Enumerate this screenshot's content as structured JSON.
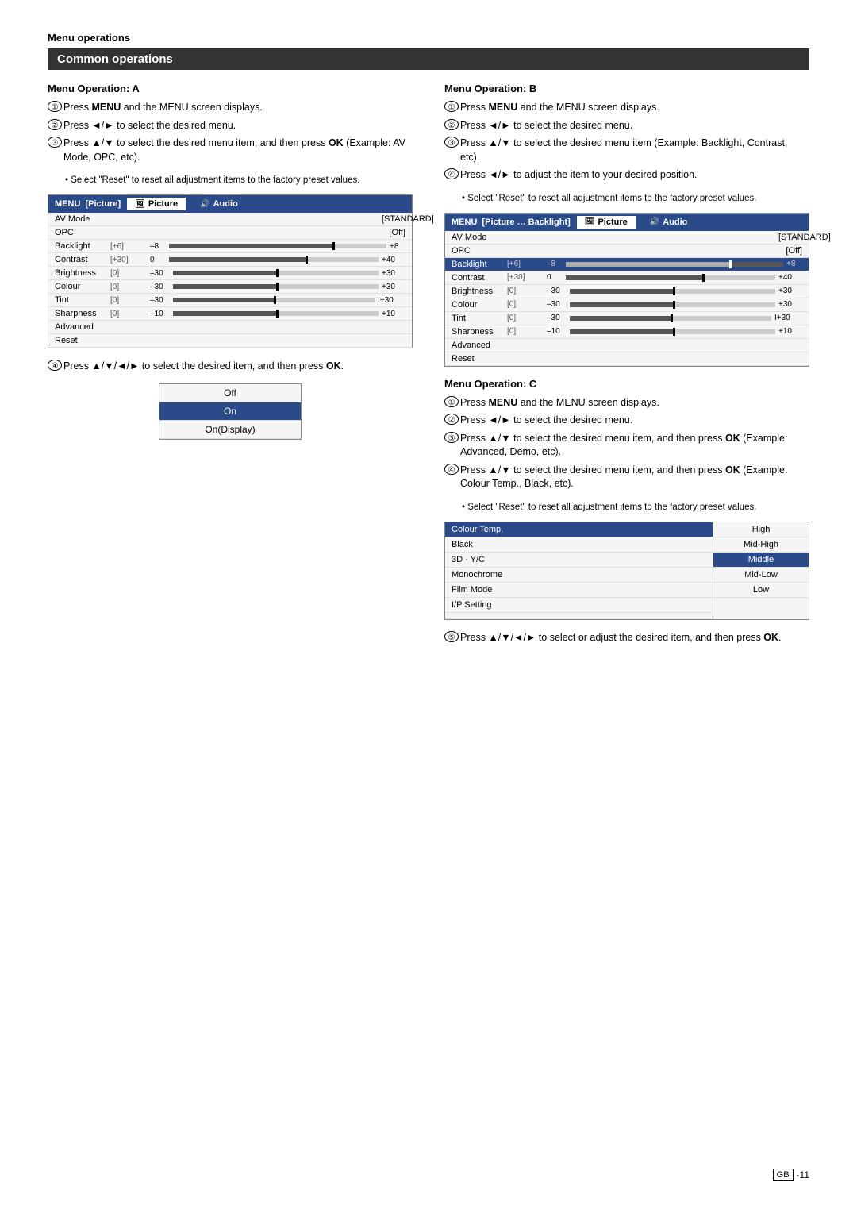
{
  "page": {
    "section_label": "Menu operations",
    "main_title": "Common operations",
    "col_left": {
      "section_title": "Menu Operation: A",
      "steps": [
        {
          "num": "①",
          "text": "Press <b>MENU</b> and the MENU screen displays."
        },
        {
          "num": "②",
          "text": "Press ◄/► to select the desired menu."
        },
        {
          "num": "③",
          "text": "Press ▲/▼ to select the desired menu item, and then press <b>OK</b> (Example: AV Mode, OPC, etc).",
          "bullet": "• Select \"Reset\" to reset all adjustment items to the factory preset values."
        },
        {
          "num": "④",
          "text": "Press ▲/▼/◄/► to select the desired item, and then press <b>OK</b>."
        }
      ],
      "menu_a": {
        "header_label": "MENU",
        "header_tab": "[Picture]",
        "tab1": "Picture",
        "tab2": "Audio",
        "rows": [
          {
            "label": "AV Mode",
            "range": "",
            "value": "[STANDARD]",
            "type": "text"
          },
          {
            "label": "OPC",
            "range": "",
            "value": "[Off]",
            "type": "text"
          },
          {
            "label": "Backlight",
            "range": "[+6]",
            "min": "–8",
            "max": "+8",
            "pos": 75,
            "type": "slider"
          },
          {
            "label": "Contrast",
            "range": "[+30]",
            "min": "0",
            "max": "+40",
            "pos": 65,
            "type": "slider"
          },
          {
            "label": "Brightness",
            "range": "[0]",
            "min": "–30",
            "max": "+30",
            "pos": 50,
            "type": "slider"
          },
          {
            "label": "Colour",
            "range": "[0]",
            "min": "–30",
            "max": "+30",
            "pos": 50,
            "type": "slider"
          },
          {
            "label": "Tint",
            "range": "[0]",
            "min": "–30",
            "max": "I+30",
            "pos": 50,
            "type": "slider"
          },
          {
            "label": "Sharpness",
            "range": "[0]",
            "min": "–10",
            "max": "+10",
            "pos": 50,
            "type": "slider"
          },
          {
            "label": "Advanced",
            "range": "",
            "value": "",
            "type": "link"
          },
          {
            "label": "Reset",
            "range": "",
            "value": "",
            "type": "link"
          }
        ]
      },
      "submenu": {
        "items": [
          "Off",
          "On",
          "On(Display)"
        ],
        "selected": 1
      }
    },
    "col_right": {
      "section_b_title": "Menu Operation: B",
      "steps_b": [
        {
          "num": "①",
          "text": "Press <b>MENU</b> and the MENU screen displays."
        },
        {
          "num": "②",
          "text": "Press ◄/► to select the desired menu."
        },
        {
          "num": "③",
          "text": "Press ▲/▼ to select the desired menu item (Example: Backlight, Contrast, etc)."
        },
        {
          "num": "④",
          "text": "Press ◄/► to adjust the item to your desired position.",
          "bullet": "• Select \"Reset\" to reset all adjustment items to the factory preset values."
        }
      ],
      "menu_b": {
        "header_label": "MENU",
        "header_tab": "[Picture … Backlight]",
        "tab1": "Picture",
        "tab2": "Audio",
        "rows": [
          {
            "label": "AV Mode",
            "range": "",
            "value": "[STANDARD]",
            "type": "text"
          },
          {
            "label": "OPC",
            "range": "",
            "value": "[Off]",
            "type": "text"
          },
          {
            "label": "Backlight",
            "range": "[+6]",
            "min": "–8",
            "max": "+8",
            "pos": 75,
            "type": "slider",
            "highlighted": true
          },
          {
            "label": "Contrast",
            "range": "[+30]",
            "min": "0",
            "max": "+40",
            "pos": 65,
            "type": "slider"
          },
          {
            "label": "Brightness",
            "range": "[0]",
            "min": "–30",
            "max": "+30",
            "pos": 50,
            "type": "slider"
          },
          {
            "label": "Colour",
            "range": "[0]",
            "min": "–30",
            "max": "+30",
            "pos": 50,
            "type": "slider"
          },
          {
            "label": "Tint",
            "range": "[0]",
            "min": "–30",
            "max": "I+30",
            "pos": 50,
            "type": "slider"
          },
          {
            "label": "Sharpness",
            "range": "[0]",
            "min": "–10",
            "max": "+10",
            "pos": 50,
            "type": "slider"
          },
          {
            "label": "Advanced",
            "range": "",
            "value": "",
            "type": "link"
          },
          {
            "label": "Reset",
            "range": "",
            "value": "",
            "type": "link"
          }
        ]
      },
      "section_c_title": "Menu Operation: C",
      "steps_c": [
        {
          "num": "①",
          "text": "Press <b>MENU</b> and the MENU screen displays."
        },
        {
          "num": "②",
          "text": "Press ◄/► to select the desired menu."
        },
        {
          "num": "③",
          "text": "Press ▲/▼ to select the desired menu item, and then press <b>OK</b> (Example: Advanced, Demo, etc)."
        },
        {
          "num": "④",
          "text": "Press ▲/▼ to select the desired menu item, and then press <b>OK</b> (Example: Colour Temp., Black, etc).",
          "bullet": "• Select \"Reset\" to reset all adjustment items to the factory preset values."
        },
        {
          "num": "⑤",
          "text": "Press ▲/▼/◄/► to select or adjust the desired item, and then press <b>OK</b>."
        }
      ],
      "menu_c": {
        "left_items": [
          "Colour Temp.",
          "Black",
          "3D · Y/C",
          "Monochrome",
          "Film Mode",
          "I/P Setting"
        ],
        "selected_left": 0,
        "right_options": [
          "High",
          "Mid-High",
          "Middle",
          "Mid-Low",
          "Low"
        ],
        "selected_right": 2
      }
    },
    "footer": {
      "gb_badge": "GB",
      "page_num": "-11"
    }
  }
}
